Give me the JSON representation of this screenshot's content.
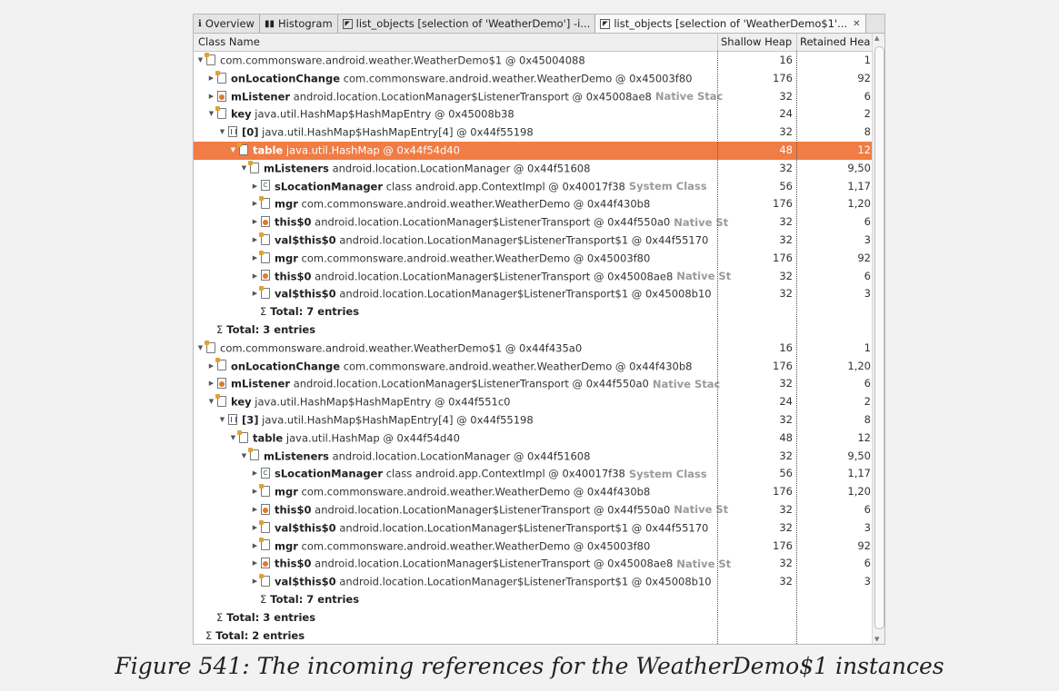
{
  "tabs": [
    {
      "label": "Overview",
      "icon": "info-icon"
    },
    {
      "label": "Histogram",
      "icon": "histogram-icon"
    },
    {
      "label": "list_objects [selection of 'WeatherDemo'] -i...",
      "icon": "query-icon"
    },
    {
      "label": "list_objects [selection of 'WeatherDemo$1'...",
      "icon": "query-icon",
      "active": true,
      "close": "✕"
    }
  ],
  "columns": {
    "name": "Class Name",
    "shallow": "Shallow Heap",
    "retained": "Retained Heap"
  },
  "rows": [
    {
      "indent": 0,
      "toggle": "open",
      "icon": "obj",
      "bold": "",
      "rest": "com.commonsware.android.weather.WeatherDemo$1 @ 0x45004088",
      "tag": "",
      "shallow": "16",
      "retained": "1"
    },
    {
      "indent": 1,
      "toggle": "closed",
      "icon": "obj",
      "bold": "onLocationChange",
      "rest": "com.commonsware.android.weather.WeatherDemo @ 0x45003f80",
      "tag": "",
      "shallow": "176",
      "retained": "92"
    },
    {
      "indent": 1,
      "toggle": "closed",
      "icon": "gc",
      "bold": "mListener",
      "rest": "android.location.LocationManager$ListenerTransport @ 0x45008ae8",
      "tag": "Native Stac",
      "shallow": "32",
      "retained": "6"
    },
    {
      "indent": 1,
      "toggle": "open",
      "icon": "obj",
      "bold": "key",
      "rest": "java.util.HashMap$HashMapEntry @ 0x45008b38",
      "tag": "",
      "shallow": "24",
      "retained": "2"
    },
    {
      "indent": 2,
      "toggle": "open",
      "icon": "arr",
      "bold": "[0]",
      "rest": "java.util.HashMap$HashMapEntry[4] @ 0x44f55198",
      "tag": "",
      "shallow": "32",
      "retained": "8"
    },
    {
      "indent": 3,
      "toggle": "open",
      "icon": "obj",
      "bold": "table",
      "rest": "java.util.HashMap @ 0x44f54d40",
      "tag": "",
      "shallow": "48",
      "retained": "12",
      "selected": true
    },
    {
      "indent": 4,
      "toggle": "open",
      "icon": "obj",
      "bold": "mListeners",
      "rest": "android.location.LocationManager @ 0x44f51608",
      "tag": "",
      "shallow": "32",
      "retained": "9,50"
    },
    {
      "indent": 5,
      "toggle": "closed",
      "icon": "cls",
      "bold": "sLocationManager",
      "rest": "class android.app.ContextImpl @ 0x40017f38",
      "tag": "System Class",
      "shallow": "56",
      "retained": "1,17"
    },
    {
      "indent": 5,
      "toggle": "closed",
      "icon": "obj",
      "bold": "mgr",
      "rest": "com.commonsware.android.weather.WeatherDemo @ 0x44f430b8",
      "tag": "",
      "shallow": "176",
      "retained": "1,20"
    },
    {
      "indent": 5,
      "toggle": "closed",
      "icon": "gc",
      "bold": "this$0",
      "rest": "android.location.LocationManager$ListenerTransport @ 0x44f550a0",
      "tag": "Native St",
      "shallow": "32",
      "retained": "6"
    },
    {
      "indent": 5,
      "toggle": "closed",
      "icon": "obj",
      "bold": "val$this$0",
      "rest": "android.location.LocationManager$ListenerTransport$1 @ 0x44f55170",
      "tag": "",
      "shallow": "32",
      "retained": "3"
    },
    {
      "indent": 5,
      "toggle": "closed",
      "icon": "obj",
      "bold": "mgr",
      "rest": "com.commonsware.android.weather.WeatherDemo @ 0x45003f80",
      "tag": "",
      "shallow": "176",
      "retained": "92"
    },
    {
      "indent": 5,
      "toggle": "closed",
      "icon": "gc",
      "bold": "this$0",
      "rest": "android.location.LocationManager$ListenerTransport @ 0x45008ae8",
      "tag": "Native St",
      "shallow": "32",
      "retained": "6"
    },
    {
      "indent": 5,
      "toggle": "closed",
      "icon": "obj",
      "bold": "val$this$0",
      "rest": "android.location.LocationManager$ListenerTransport$1 @ 0x45008b10",
      "tag": "",
      "shallow": "32",
      "retained": "3"
    },
    {
      "indent": 5,
      "toggle": "none",
      "icon": "sigma",
      "bold": "Total: 7 entries",
      "rest": "",
      "tag": "",
      "shallow": "",
      "retained": ""
    },
    {
      "indent": 1,
      "toggle": "none",
      "icon": "sigma",
      "bold": "Total: 3 entries",
      "rest": "",
      "tag": "",
      "shallow": "",
      "retained": ""
    },
    {
      "indent": 0,
      "toggle": "open",
      "icon": "obj",
      "bold": "",
      "rest": "com.commonsware.android.weather.WeatherDemo$1 @ 0x44f435a0",
      "tag": "",
      "shallow": "16",
      "retained": "1"
    },
    {
      "indent": 1,
      "toggle": "closed",
      "icon": "obj",
      "bold": "onLocationChange",
      "rest": "com.commonsware.android.weather.WeatherDemo @ 0x44f430b8",
      "tag": "",
      "shallow": "176",
      "retained": "1,20"
    },
    {
      "indent": 1,
      "toggle": "closed",
      "icon": "gc",
      "bold": "mListener",
      "rest": "android.location.LocationManager$ListenerTransport @ 0x44f550a0",
      "tag": "Native Stac",
      "shallow": "32",
      "retained": "6"
    },
    {
      "indent": 1,
      "toggle": "open",
      "icon": "obj",
      "bold": "key",
      "rest": "java.util.HashMap$HashMapEntry @ 0x44f551c0",
      "tag": "",
      "shallow": "24",
      "retained": "2"
    },
    {
      "indent": 2,
      "toggle": "open",
      "icon": "arr",
      "bold": "[3]",
      "rest": "java.util.HashMap$HashMapEntry[4] @ 0x44f55198",
      "tag": "",
      "shallow": "32",
      "retained": "8"
    },
    {
      "indent": 3,
      "toggle": "open",
      "icon": "obj",
      "bold": "table",
      "rest": "java.util.HashMap @ 0x44f54d40",
      "tag": "",
      "shallow": "48",
      "retained": "12"
    },
    {
      "indent": 4,
      "toggle": "open",
      "icon": "obj",
      "bold": "mListeners",
      "rest": "android.location.LocationManager @ 0x44f51608",
      "tag": "",
      "shallow": "32",
      "retained": "9,50"
    },
    {
      "indent": 5,
      "toggle": "closed",
      "icon": "cls",
      "bold": "sLocationManager",
      "rest": "class android.app.ContextImpl @ 0x40017f38",
      "tag": "System Class",
      "shallow": "56",
      "retained": "1,17"
    },
    {
      "indent": 5,
      "toggle": "closed",
      "icon": "obj",
      "bold": "mgr",
      "rest": "com.commonsware.android.weather.WeatherDemo @ 0x44f430b8",
      "tag": "",
      "shallow": "176",
      "retained": "1,20"
    },
    {
      "indent": 5,
      "toggle": "closed",
      "icon": "gc",
      "bold": "this$0",
      "rest": "android.location.LocationManager$ListenerTransport @ 0x44f550a0",
      "tag": "Native St",
      "shallow": "32",
      "retained": "6"
    },
    {
      "indent": 5,
      "toggle": "closed",
      "icon": "obj",
      "bold": "val$this$0",
      "rest": "android.location.LocationManager$ListenerTransport$1 @ 0x44f55170",
      "tag": "",
      "shallow": "32",
      "retained": "3"
    },
    {
      "indent": 5,
      "toggle": "closed",
      "icon": "obj",
      "bold": "mgr",
      "rest": "com.commonsware.android.weather.WeatherDemo @ 0x45003f80",
      "tag": "",
      "shallow": "176",
      "retained": "92"
    },
    {
      "indent": 5,
      "toggle": "closed",
      "icon": "gc",
      "bold": "this$0",
      "rest": "android.location.LocationManager$ListenerTransport @ 0x45008ae8",
      "tag": "Native St",
      "shallow": "32",
      "retained": "6"
    },
    {
      "indent": 5,
      "toggle": "closed",
      "icon": "obj",
      "bold": "val$this$0",
      "rest": "android.location.LocationManager$ListenerTransport$1 @ 0x45008b10",
      "tag": "",
      "shallow": "32",
      "retained": "3"
    },
    {
      "indent": 5,
      "toggle": "none",
      "icon": "sigma",
      "bold": "Total: 7 entries",
      "rest": "",
      "tag": "",
      "shallow": "",
      "retained": ""
    },
    {
      "indent": 1,
      "toggle": "none",
      "icon": "sigma",
      "bold": "Total: 3 entries",
      "rest": "",
      "tag": "",
      "shallow": "",
      "retained": ""
    },
    {
      "indent": 0,
      "toggle": "none",
      "icon": "sigma",
      "bold": "Total: 2 entries",
      "rest": "",
      "tag": "",
      "shallow": "",
      "retained": ""
    }
  ],
  "caption": "Figure 541: The incoming references for the WeatherDemo$1 instances",
  "colors": {
    "selection": "#f07c46",
    "tag_gray": "#9a9a9a"
  }
}
